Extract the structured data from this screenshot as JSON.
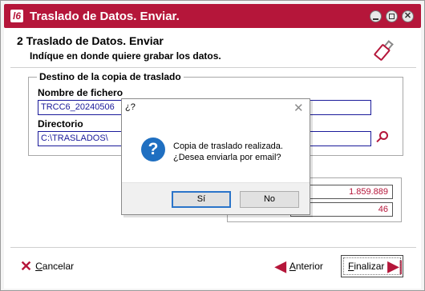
{
  "window": {
    "title": "Traslado de Datos. Enviar.",
    "app_icon": "app-logo-icon",
    "accent_color": "#b5163a"
  },
  "header": {
    "step_title": "2 Traslado de Datos. Enviar",
    "step_subtitle": "Indíque en donde quiere grabar los datos.",
    "icon": "usb-drive-icon"
  },
  "destination_group": {
    "legend": "Destino de la copia de traslado",
    "filename_label": "Nombre de fichero",
    "filename_value": "TRCC6_20240506",
    "directory_label": "Directorio",
    "directory_value": "C:\\TRASLADOS\\",
    "browse_icon": "search-icon"
  },
  "stats": {
    "value_1": "1.859.889",
    "value_2": "46"
  },
  "footer": {
    "cancel_label": "Cancelar",
    "back_label": "Anterior",
    "finish_label": "Finalizar"
  },
  "dialog": {
    "title": "¿?",
    "icon": "question-icon",
    "message_line1": "Copia de traslado realizada.",
    "message_line2": "¿Desea enviarla por email?",
    "yes_label": "Sí",
    "no_label": "No"
  }
}
